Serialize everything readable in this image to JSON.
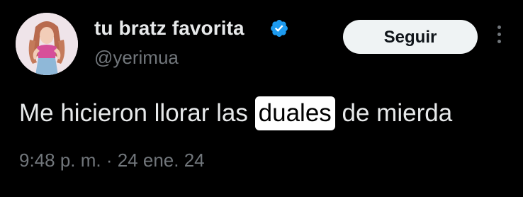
{
  "author": {
    "display_name": "tu bratz favorita",
    "handle": "@yerimua",
    "verified": true,
    "verified_color": "#1d9bf0",
    "avatar_icon": "profile-photo"
  },
  "actions": {
    "follow_label": "Seguir",
    "more_icon": "more-vertical-icon"
  },
  "tweet": {
    "text_before": "Me hicieron llorar las",
    "text_highlight": "duales",
    "text_after": "de mierda",
    "timestamp": "9:48 p. m. · 24 ene. 24"
  },
  "colors": {
    "background": "#000000",
    "primary_text": "#e7e9ea",
    "secondary_text": "#71767b",
    "button_bg": "#eff3f4",
    "highlight_bg": "#ffffff"
  }
}
